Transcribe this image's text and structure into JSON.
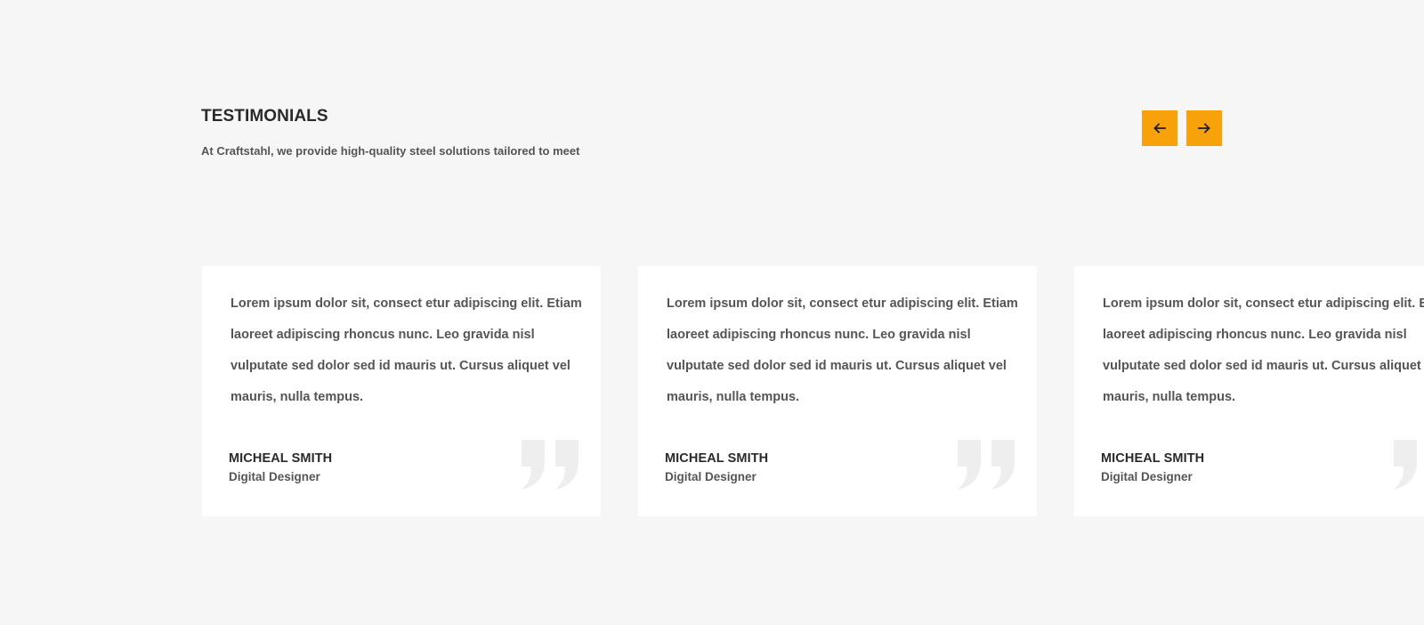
{
  "section": {
    "title": "TESTIMONIALS",
    "subtitle": "At Craftstahl, we provide high-quality steel solutions tailored to meet"
  },
  "navigation": {
    "prev_icon": "arrow-left-icon",
    "next_icon": "arrow-right-icon",
    "accent_color": "#f7a20b"
  },
  "testimonials": [
    {
      "text": "Lorem ipsum dolor sit, consect etur adipiscing elit. Etiam laoreet adipiscing rhoncus nunc. Leo gravida nisl vulputate sed dolor sed id mauris ut. Cursus aliquet vel mauris, nulla tempus.",
      "name": "MICHEAL SMITH",
      "role": "Digital Designer",
      "icon": "quote-icon"
    },
    {
      "text": "Lorem ipsum dolor sit, consect etur adipiscing elit. Etiam laoreet adipiscing rhoncus nunc. Leo gravida nisl vulputate sed dolor sed id mauris ut. Cursus aliquet vel mauris, nulla tempus.",
      "name": "MICHEAL SMITH",
      "role": "Digital Designer",
      "icon": "quote-icon"
    },
    {
      "text": "Lorem ipsum dolor sit, consect etur adipiscing elit. Etiam laoreet adipiscing rhoncus nunc. Leo gravida nisl vulputate sed dolor sed id mauris ut. Cursus aliquet vel mauris, nulla tempus.",
      "name": "MICHEAL SMITH",
      "role": "Digital Designer",
      "icon": "quote-icon"
    }
  ],
  "colors": {
    "background": "#f6f6f6",
    "card": "#ffffff",
    "heading": "#2a2a2a",
    "body_text": "#555555",
    "quote_mark": "#eeeeee"
  }
}
